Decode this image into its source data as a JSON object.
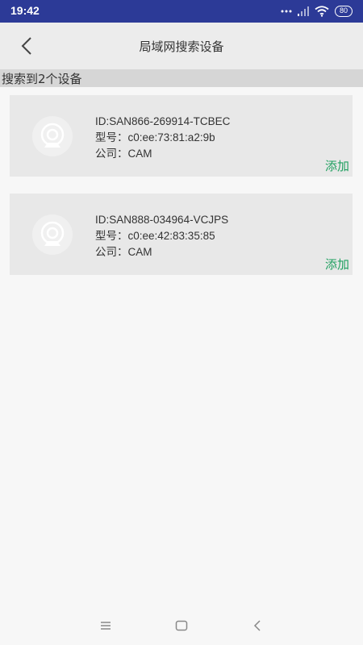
{
  "status": {
    "time": "19:42",
    "battery": "80",
    "icons": [
      "dots-icon",
      "signal-icon",
      "wifi-icon",
      "battery-icon"
    ]
  },
  "header": {
    "title": "局域网搜索设备",
    "back_icon": "chevron-left-icon"
  },
  "result": {
    "text": "搜索到2个设备"
  },
  "devices": [
    {
      "id_text": "ID:SAN866-269914-TCBEC",
      "model_text": "型号：c0:ee:73:81:a2:9b",
      "company_text": "公司：CAM",
      "add_label": "添加",
      "icon": "camera-icon"
    },
    {
      "id_text": "ID:SAN888-034964-VCJPS",
      "model_text": "型号：c0:ee:42:83:35:85",
      "company_text": "公司：CAM",
      "add_label": "添加",
      "icon": "camera-icon"
    }
  ],
  "nav": {
    "icons": [
      "menu-icon",
      "home-icon",
      "back-icon"
    ]
  },
  "colors": {
    "status_bar": "#2c3a97",
    "header_bg": "#ececec",
    "result_bar": "#d6d6d6",
    "card_bg": "#e8e8e8",
    "accent_green": "#20a060",
    "page_bg": "#f7f7f7"
  }
}
